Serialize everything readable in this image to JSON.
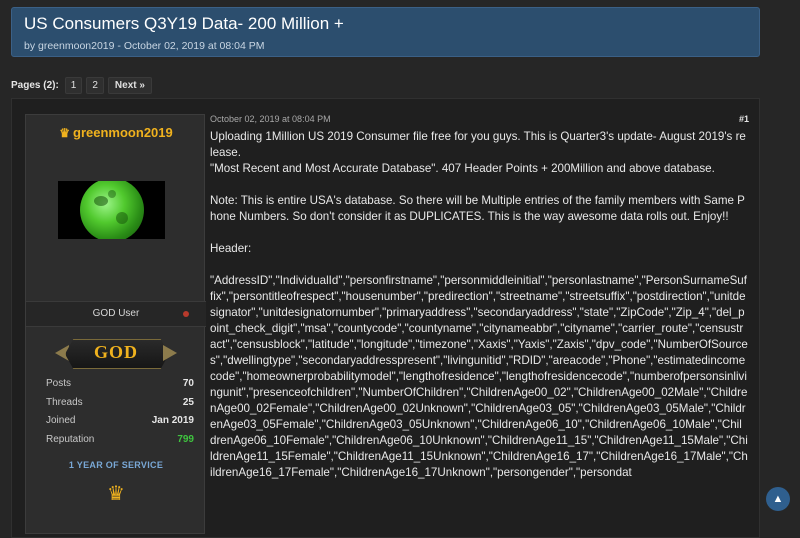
{
  "thread": {
    "title": "US Consumers Q3Y19 Data- 200 Million +",
    "meta": "by greenmoon2019 - October 02, 2019 at 08:04 PM"
  },
  "pagination": {
    "label": "Pages (2):",
    "pages": [
      "1",
      "2"
    ],
    "next": "Next »"
  },
  "user": {
    "name": "greenmoon2019",
    "role": "GOD User",
    "rank_badge": "GOD",
    "stats": [
      {
        "label": "Posts",
        "value": "70"
      },
      {
        "label": "Threads",
        "value": "25"
      },
      {
        "label": "Joined",
        "value": "Jan 2019"
      },
      {
        "label": "Reputation",
        "value": "799"
      }
    ],
    "service": "1 YEAR OF SERVICE"
  },
  "post": {
    "date": "October 02, 2019 at 08:04 PM",
    "number": "#1",
    "para1_line1": "Uploading 1Million US 2019 Consumer file free for you guys. This is Quarter3's update- August 2019's release.",
    "para1_line2": "\"Most Recent and Most Accurate Database\". 407 Header Points + 200Million and above database.",
    "para2": "Note: This is entire USA's database. So there will be Multiple entries of the family members with Same Phone Numbers. So don't consider it as DUPLICATES. This is the way awesome data rolls out. Enjoy!!",
    "header_label": "Header:",
    "header_fields": "\"AddressID\",\"IndividualId\",\"personfirstname\",\"personmiddleinitial\",\"personlastname\",\"PersonSurnameSuffix\",\"persontitleofrespect\",\"housenumber\",\"predirection\",\"streetname\",\"streetsuffix\",\"postdirection\",\"unitdesignator\",\"unitdesignatornumber\",\"primaryaddress\",\"secondaryaddress\",\"state\",\"ZipCode\",\"Zip_4\",\"del_point_check_digit\",\"msa\",\"countycode\",\"countyname\",\"citynameabbr\",\"cityname\",\"carrier_route\",\"censustract\",\"censusblock\",\"latitude\",\"longitude\",\"timezone\",\"Xaxis\",\"Yaxis\",\"Zaxis\",\"dpv_code\",\"NumberOfSources\",\"dwellingtype\",\"secondaryaddresspresent\",\"livingunitid\",\"RDID\",\"areacode\",\"Phone\",\"estimatedincomecode\",\"homeownerprobabilitymodel\",\"lengthofresidence\",\"lengthofresidencecode\",\"numberofpersonsinlivingunit\",\"presenceofchildren\",\"NumberOfChildren\",\"ChildrenAge00_02\",\"ChildrenAge00_02Male\",\"ChildrenAge00_02Female\",\"ChildrenAge00_02Unknown\",\"ChildrenAge03_05\",\"ChildrenAge03_05Male\",\"ChildrenAge03_05Female\",\"ChildrenAge03_05Unknown\",\"ChildrenAge06_10\",\"ChildrenAge06_10Male\",\"ChildrenAge06_10Female\",\"ChildrenAge06_10Unknown\",\"ChildrenAge11_15\",\"ChildrenAge11_15Male\",\"ChildrenAge11_15Female\",\"ChildrenAge11_15Unknown\",\"ChildrenAge16_17\",\"ChildrenAge16_17Male\",\"ChildrenAge16_17Female\",\"ChildrenAge16_17Unknown\",\"persongender\",\"persondat"
  },
  "icons": {
    "crown": "♛",
    "scroll_top": "▲"
  },
  "colors": {
    "header_bg": "#2c4e6e",
    "username": "#f0b21e",
    "reputation": "#3fc43f",
    "service": "#79a8d6",
    "status_dot": "#b83a2c"
  }
}
